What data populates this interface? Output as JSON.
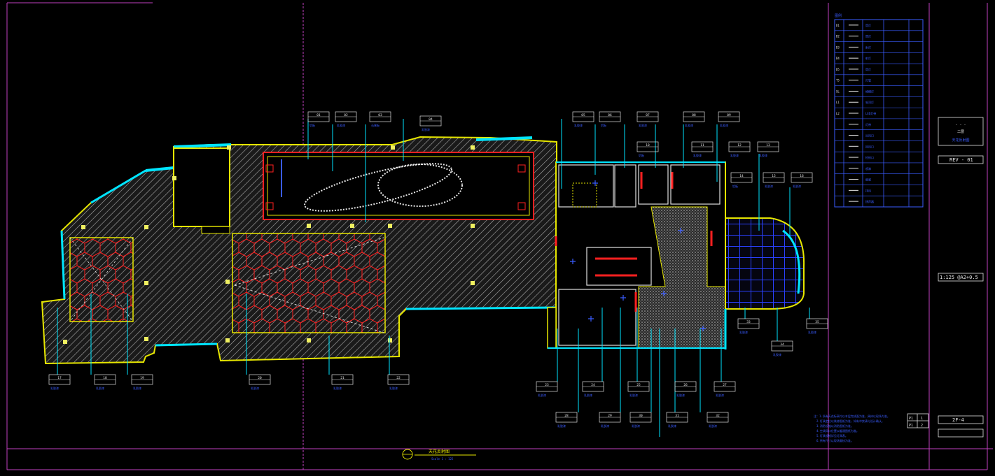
{
  "drawing": {
    "title": "天花反射图",
    "scale_note": "Scale 1 : 125",
    "rev": "REV - 01",
    "scale": "1:125 @A2+0.5",
    "sheet_no": "2F-4",
    "title_block_top": "- - -",
    "title_block_line1": "二层",
    "title_block_line2": "天花反射图",
    "sheet_rows": [
      {
        "label": "P1",
        "value": "1"
      },
      {
        "label": "P1",
        "value": "2"
      }
    ]
  },
  "legend": {
    "title": "图例",
    "rows": [
      {
        "code": "D1",
        "desc": "筒灯"
      },
      {
        "code": "D2",
        "desc": "筒灯"
      },
      {
        "code": "D3",
        "desc": "射灯"
      },
      {
        "code": "D4",
        "desc": "射灯"
      },
      {
        "code": "D5",
        "desc": "筒灯"
      },
      {
        "code": "T5",
        "desc": "灯管"
      },
      {
        "code": "SL",
        "desc": "格栅灯"
      },
      {
        "code": "L1",
        "desc": "吸顶灯"
      },
      {
        "code": "L2",
        "desc": "LED灯带"
      },
      {
        "code": "",
        "desc": "灯带"
      },
      {
        "code": "",
        "desc": "出风口"
      },
      {
        "code": "",
        "desc": "回风口"
      },
      {
        "code": "",
        "desc": "检修口"
      },
      {
        "code": "",
        "desc": "喷淋"
      },
      {
        "code": "",
        "desc": "烟感"
      },
      {
        "code": "",
        "desc": "排风"
      },
      {
        "code": "",
        "desc": "扬声器"
      }
    ]
  },
  "notes": [
    "注：1.所有天花标高均以本层完成面为准，具体以现场为准。",
    "2.灯具定位以装修图纸为准，如有冲突请与设计确认。",
    "3.消防设施以消防图纸为准。",
    "4.空调风口位置以暖通图纸为准。",
    "5.灯具规格详见灯具表。",
    "6.所有尺寸以现场复核为准。"
  ],
  "tags": [
    {
      "id": "01",
      "desc": "铝板"
    },
    {
      "id": "02",
      "desc": "乳胶漆"
    },
    {
      "id": "03",
      "desc": "石膏板"
    },
    {
      "id": "04",
      "desc": "乳胶漆"
    },
    {
      "id": "05",
      "desc": "乳胶漆"
    },
    {
      "id": "06",
      "desc": "铝板"
    },
    {
      "id": "07",
      "desc": "乳胶漆"
    },
    {
      "id": "08",
      "desc": "乳胶漆"
    },
    {
      "id": "09",
      "desc": "乳胶漆"
    },
    {
      "id": "10",
      "desc": "铝板"
    },
    {
      "id": "11",
      "desc": "乳胶漆"
    },
    {
      "id": "12",
      "desc": "乳胶漆"
    },
    {
      "id": "13",
      "desc": "乳胶漆"
    },
    {
      "id": "14",
      "desc": "铝板"
    },
    {
      "id": "15",
      "desc": "乳胶漆"
    },
    {
      "id": "16",
      "desc": "乳胶漆"
    },
    {
      "id": "17",
      "desc": "乳胶漆"
    },
    {
      "id": "18",
      "desc": "乳胶漆"
    },
    {
      "id": "19",
      "desc": "乳胶漆"
    },
    {
      "id": "20",
      "desc": "乳胶漆"
    },
    {
      "id": "21",
      "desc": "乳胶漆"
    },
    {
      "id": "22",
      "desc": "乳胶漆"
    },
    {
      "id": "23",
      "desc": "乳胶漆"
    },
    {
      "id": "24",
      "desc": "乳胶漆"
    },
    {
      "id": "25",
      "desc": "乳胶漆"
    },
    {
      "id": "26",
      "desc": "乳胶漆"
    },
    {
      "id": "27",
      "desc": "乳胶漆"
    },
    {
      "id": "28",
      "desc": "乳胶漆"
    },
    {
      "id": "29",
      "desc": "乳胶漆"
    },
    {
      "id": "30",
      "desc": "乳胶漆"
    },
    {
      "id": "31",
      "desc": "乳胶漆"
    },
    {
      "id": "32",
      "desc": "乳胶漆"
    },
    {
      "id": "33",
      "desc": "乳胶漆"
    },
    {
      "id": "34",
      "desc": "乳胶漆"
    },
    {
      "id": "35",
      "desc": "乳胶漆"
    }
  ],
  "colors": {
    "background": "#000000",
    "frame": "#c040c0",
    "wall": "#e6e600",
    "hatch": "#b8b8b8",
    "accent_cyan": "#00e5ff",
    "tag_blue": "#3a5cff",
    "ceiling_red": "#ff2020",
    "white": "#ffffff"
  }
}
